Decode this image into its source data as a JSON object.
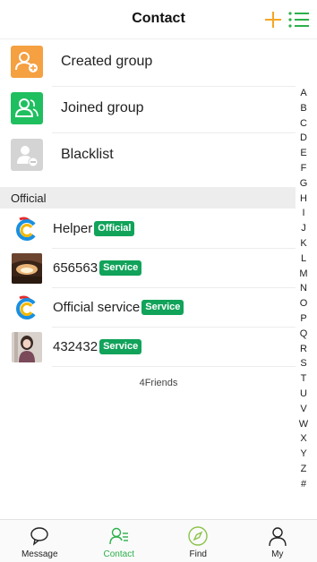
{
  "header": {
    "title": "Contact",
    "accent_color": "#f5a623",
    "list_color": "#2bb04a"
  },
  "menu": [
    {
      "label": "Created group",
      "icon": "group-add-icon",
      "color": "#f5a041"
    },
    {
      "label": "Joined group",
      "icon": "group-icon",
      "color": "#1fbf5f"
    },
    {
      "label": "Blacklist",
      "icon": "user-block-icon",
      "color": "#d4d4d4"
    }
  ],
  "section": {
    "label": "Official"
  },
  "friends": [
    {
      "name": "Helper",
      "badge": "Official",
      "avatar": "official-logo-icon"
    },
    {
      "name": "656563",
      "badge": "Service",
      "avatar": "photo-avatar"
    },
    {
      "name": "Official service",
      "badge": "Service",
      "avatar": "official-logo-icon"
    },
    {
      "name": "432432",
      "badge": "Service",
      "avatar": "photo-avatar"
    }
  ],
  "friends_count": "4Friends",
  "alpha_index": [
    "A",
    "B",
    "C",
    "D",
    "E",
    "F",
    "G",
    "H",
    "I",
    "J",
    "K",
    "L",
    "M",
    "N",
    "O",
    "P",
    "Q",
    "R",
    "S",
    "T",
    "U",
    "V",
    "W",
    "X",
    "Y",
    "Z",
    "#"
  ],
  "tabs": [
    {
      "label": "Message",
      "icon": "chat-bubble-icon",
      "active": false
    },
    {
      "label": "Contact",
      "icon": "contacts-icon",
      "active": true
    },
    {
      "label": "Find",
      "icon": "compass-icon",
      "active": false
    },
    {
      "label": "My",
      "icon": "person-icon",
      "active": false
    }
  ],
  "badge_color": "#11a35a"
}
